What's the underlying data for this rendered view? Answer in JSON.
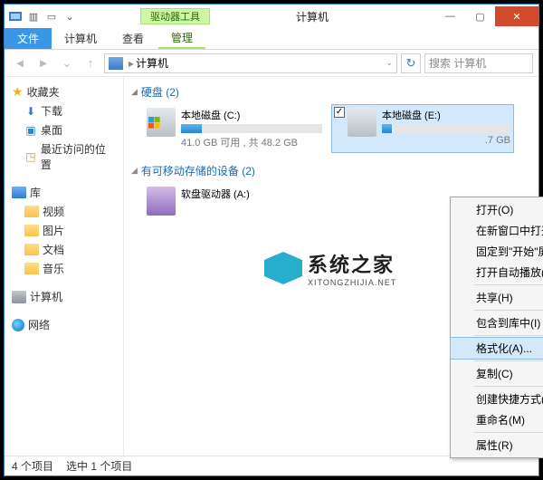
{
  "titlebar": {
    "tools_tab": "驱动器工具",
    "window_title": "计算机"
  },
  "ribbon": {
    "file": "文件",
    "computer": "计算机",
    "view": "查看",
    "manage": "管理"
  },
  "addr": {
    "location": "计算机",
    "search_placeholder": "搜索 计算机"
  },
  "sidebar": {
    "favorites": "收藏夹",
    "downloads": "下载",
    "desktop": "桌面",
    "recent": "最近访问的位置",
    "libraries": "库",
    "videos": "视频",
    "pictures": "图片",
    "documents": "文档",
    "music": "音乐",
    "computer": "计算机",
    "network": "网络"
  },
  "content": {
    "section_hdd": "硬盘 (2)",
    "section_removable": "有可移动存储的设备 (2)",
    "drive_c": {
      "label": "本地磁盘 (C:)",
      "free": "41.0 GB 可用 , 共 48.2 GB"
    },
    "drive_e": {
      "label": "本地磁盘 (E:)",
      "free_tail": ".7 GB"
    },
    "drive_a": {
      "label": "软盘驱动器 (A:)"
    }
  },
  "ctxmenu": {
    "open": "打开(O)",
    "open_new": "在新窗口中打开(E)",
    "pin_start": "固定到\"开始\"屏幕(P)",
    "autoplay": "打开自动播放(Y)...",
    "share": "共享(H)",
    "include_lib": "包含到库中(I)",
    "format": "格式化(A)...",
    "copy": "复制(C)",
    "shortcut": "创建快捷方式(S)",
    "rename": "重命名(M)",
    "props": "属性(R)"
  },
  "watermark": {
    "brand": "系统之家",
    "url": "XITONGZHIJIA.NET"
  },
  "status": {
    "items": "4 个项目",
    "selected": "选中 1 个项目"
  }
}
